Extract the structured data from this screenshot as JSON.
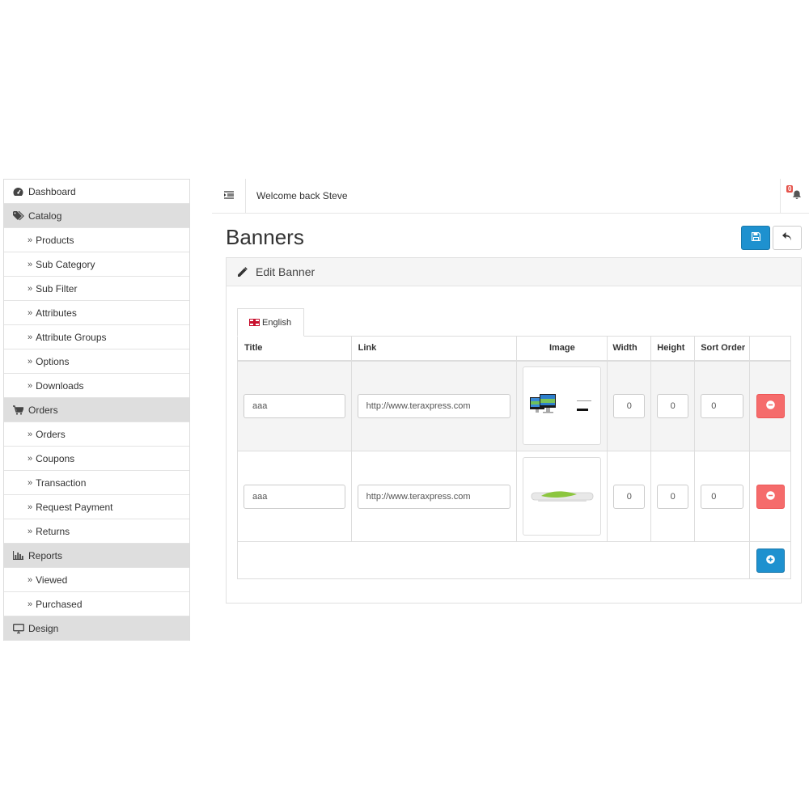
{
  "sidebar": {
    "items": [
      {
        "label": "Dashboard",
        "level": "top",
        "icon": "dashboard-icon"
      },
      {
        "label": "Catalog",
        "level": "top",
        "icon": "tags-icon"
      },
      {
        "label": "Products",
        "level": "sub"
      },
      {
        "label": "Sub Category",
        "level": "sub"
      },
      {
        "label": "Sub Filter",
        "level": "sub"
      },
      {
        "label": "Attributes",
        "level": "sub"
      },
      {
        "label": "Attribute Groups",
        "level": "sub"
      },
      {
        "label": "Options",
        "level": "sub"
      },
      {
        "label": "Downloads",
        "level": "sub"
      },
      {
        "label": "Orders",
        "level": "top",
        "icon": "cart-icon"
      },
      {
        "label": "Orders",
        "level": "sub"
      },
      {
        "label": "Coupons",
        "level": "sub"
      },
      {
        "label": "Transaction",
        "level": "sub"
      },
      {
        "label": "Request Payment",
        "level": "sub"
      },
      {
        "label": "Returns",
        "level": "sub"
      },
      {
        "label": "Reports",
        "level": "top",
        "icon": "bar-chart-icon"
      },
      {
        "label": "Viewed",
        "level": "sub"
      },
      {
        "label": "Purchased",
        "level": "sub"
      },
      {
        "label": "Design",
        "level": "top",
        "icon": "desktop-icon"
      }
    ]
  },
  "header": {
    "welcome": "Welcome back Steve",
    "notification_count": "0"
  },
  "page": {
    "title": "Banners",
    "panel_title": "Edit Banner",
    "tab_label": "English"
  },
  "table": {
    "headers": {
      "title": "Title",
      "link": "Link",
      "image": "Image",
      "width": "Width",
      "height": "Height",
      "sort_order": "Sort Order"
    },
    "rows": [
      {
        "title": "aaa",
        "link": "http://www.teraxpress.com",
        "width": "0",
        "height": "0",
        "sort_order": "0",
        "image": "imac-banner"
      },
      {
        "title": "aaa",
        "link": "http://www.teraxpress.com",
        "width": "0",
        "height": "0",
        "sort_order": "0",
        "image": "phone-banner"
      }
    ]
  },
  "thumb_text": {
    "line1": "iMac",
    "line2": "Now Available"
  },
  "colors": {
    "primary": "#1e91cf",
    "danger": "#f56b6b",
    "shaded": "#dedede"
  }
}
